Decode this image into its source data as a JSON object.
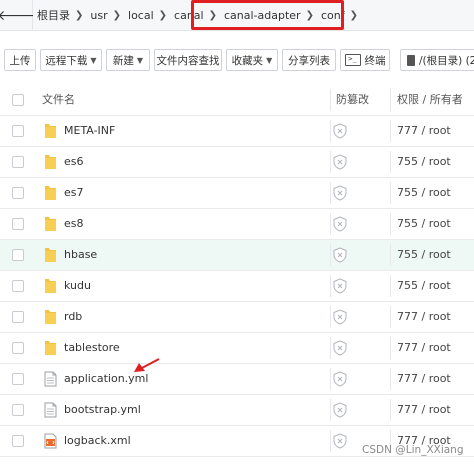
{
  "breadcrumb": {
    "items": [
      {
        "label": "根目录"
      },
      {
        "label": "usr"
      },
      {
        "label": "local"
      },
      {
        "label": "canal"
      },
      {
        "label": "canal-adapter"
      },
      {
        "label": "conf"
      }
    ],
    "sep": "❯"
  },
  "toolbar": {
    "upload": "上传",
    "remote_download": "远程下载",
    "new": "新建",
    "content_search": "文件内容查找",
    "favorites": "收藏夹",
    "share_list": "分享列表",
    "terminal": "终端",
    "terminal_icon_text": ">_",
    "disk": "/(根目录) (2"
  },
  "table": {
    "headers": {
      "name": "文件名",
      "tamper": "防篡改",
      "perm": "权限 / 所有者"
    },
    "rows": [
      {
        "name": "META-INF",
        "type": "folder",
        "perm": "777 / root"
      },
      {
        "name": "es6",
        "type": "folder",
        "perm": "755 / root"
      },
      {
        "name": "es7",
        "type": "folder",
        "perm": "755 / root"
      },
      {
        "name": "es8",
        "type": "folder",
        "perm": "755 / root"
      },
      {
        "name": "hbase",
        "type": "folder",
        "perm": "755 / root"
      },
      {
        "name": "kudu",
        "type": "folder",
        "perm": "755 / root"
      },
      {
        "name": "rdb",
        "type": "folder",
        "perm": "777 / root"
      },
      {
        "name": "tablestore",
        "type": "folder",
        "perm": "777 / root"
      },
      {
        "name": "application.yml",
        "type": "file",
        "perm": "777 / root"
      },
      {
        "name": "bootstrap.yml",
        "type": "file",
        "perm": "777 / root"
      },
      {
        "name": "logback.xml",
        "type": "xml",
        "perm": "777 / root"
      }
    ]
  },
  "watermark": "CSDN @Lin_XXiang",
  "colors": {
    "highlight": "#e02020",
    "folder": "#f5c344",
    "selected_row": "#eef8f4"
  }
}
